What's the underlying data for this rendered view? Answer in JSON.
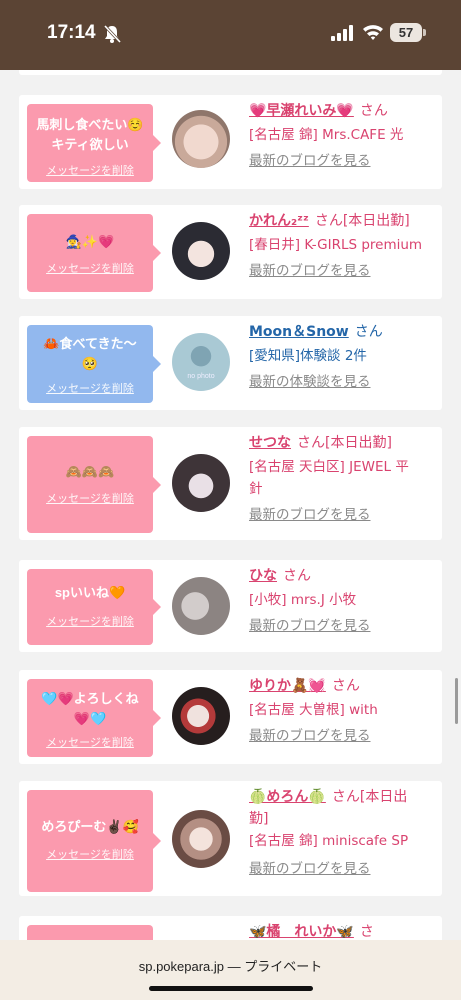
{
  "status_bar": {
    "time": "17:14",
    "battery": "57",
    "icons": [
      "bell-slash-icon",
      "signal-icon",
      "wifi-icon",
      "battery-icon"
    ]
  },
  "cards": [
    {
      "message": [
        "馬刺し食べたい☺️",
        "キティ欲しい"
      ],
      "delete_label": "メッセージを削除",
      "bubble_color": "#fb9aae",
      "name": "💗早瀬れいみ💗",
      "san": "さん",
      "tag": "",
      "shop_lines": [
        "[名古屋 錦] Mrs.CAFE 光"
      ],
      "link": "最新のブログを見る",
      "avatar_color": "#d8c5bb"
    },
    {
      "message": [
        "🧙‍♀️✨💗"
      ],
      "delete_label": "メッセージを削除",
      "bubble_color": "#fb9aae",
      "name": "かれん₂ᶻᶻ",
      "san": "さん",
      "tag": "[本日出勤]",
      "shop_lines": [
        "[春日井] K-GIRLS premium"
      ],
      "link": "最新のブログを見る",
      "avatar_color": "#3a3a44"
    },
    {
      "message": [
        "🦀食べてきた〜",
        "🥺"
      ],
      "delete_label": "メッセージを削除",
      "bubble_color": "#92b8ee",
      "name": "Moon＆Snow",
      "san": "さん",
      "tag": "",
      "shop_lines": [
        "[愛知県]体験談 2件"
      ],
      "link": "最新の体験談を見る",
      "avatar_color": "#9fc3cf",
      "avatar_text": "no photo"
    },
    {
      "message": [
        "🙈🙈🙈"
      ],
      "delete_label": "メッセージを削除",
      "bubble_color": "#fb9aae",
      "name": "せつな",
      "san": "さん",
      "tag": "[本日出勤]",
      "shop_lines": [
        "[名古屋 天白区] JEWEL 平",
        "針"
      ],
      "link": "最新のブログを見る",
      "avatar_color": "#4a4046"
    },
    {
      "message": [
        "spいいね🧡"
      ],
      "delete_label": "メッセージを削除",
      "bubble_color": "#fb9aae",
      "name": "ひな",
      "san": "さん",
      "tag": "",
      "shop_lines": [
        "[小牧] mrs.J 小牧"
      ],
      "link": "最新のブログを見る",
      "avatar_color": "#b8b2b0"
    },
    {
      "message": [
        "🩵💗よろしくね",
        "💗🩵"
      ],
      "delete_label": "メッセージを削除",
      "bubble_color": "#fb9aae",
      "name": "ゆりか🧸💓",
      "san": "さん",
      "tag": "",
      "shop_lines": [
        "[名古屋 大曽根] with"
      ],
      "link": "最新のブログを見る",
      "avatar_color": "#2c2424"
    },
    {
      "message": [
        "めろぴーむ✌🏿🥰"
      ],
      "delete_label": "メッセージを削除",
      "bubble_color": "#fb9aae",
      "name": "🍈めろん🍈",
      "san": "さん",
      "tag": "[本日出",
      "tag_cont": "勤]",
      "shop_lines": [
        "[名古屋 錦] miniscafe SP"
      ],
      "link": "最新のブログを見る",
      "avatar_color": "#caa596"
    },
    {
      "message": [],
      "delete_label": "",
      "bubble_color": "#fb9aae",
      "name": "🦋橘　れいか🦋",
      "san": "さ",
      "tag": "",
      "shop_lines": [],
      "link": "",
      "avatar_color": "#ffffff"
    }
  ],
  "browser": {
    "url": "sp.pokepara.jp — プライベート"
  }
}
